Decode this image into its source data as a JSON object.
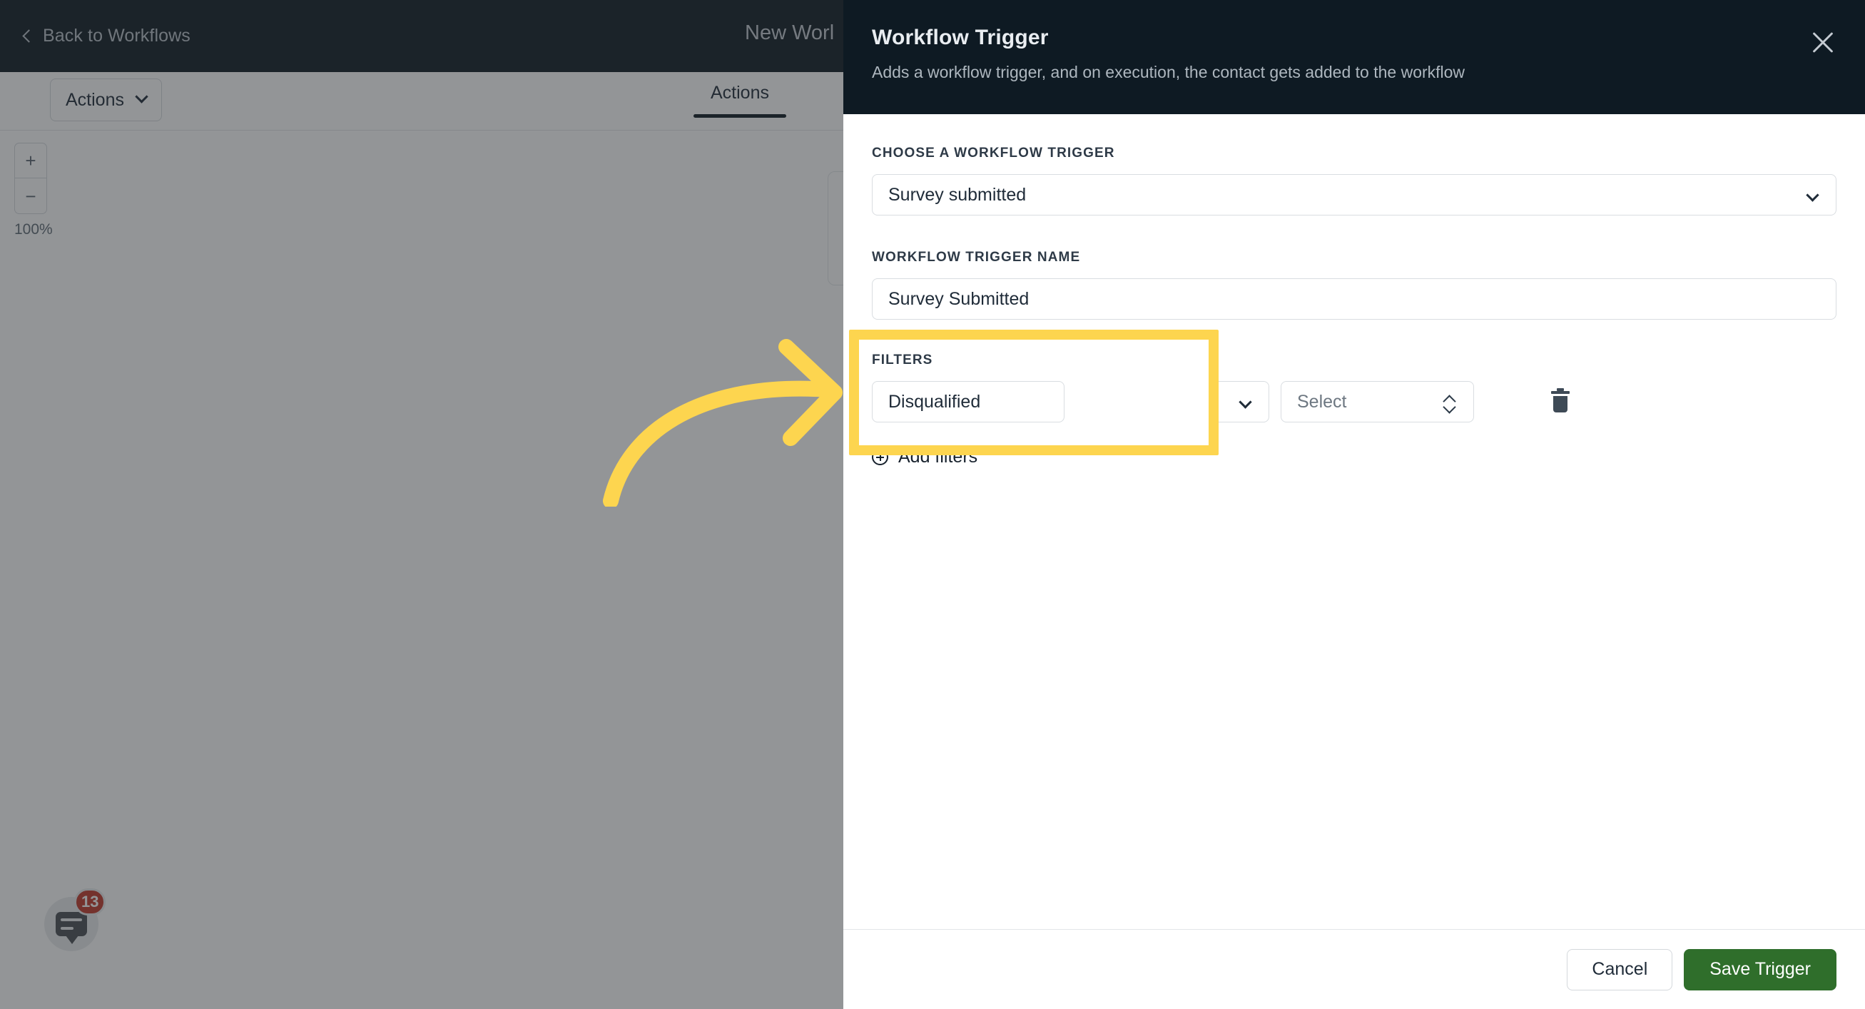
{
  "app": {
    "back_label": "Back to Workflows",
    "back_icon": "chevron-left-icon",
    "title": "New Worl",
    "actions_button": "Actions",
    "actions_caret_icon": "chevron-down-icon",
    "tab_actions": "Actions",
    "zoom_in_icon": "plus-icon",
    "zoom_out_icon": "minus-icon",
    "zoom_level": "100%",
    "chat": {
      "icon": "chat-bubble-icon",
      "badge_count": "13",
      "badge_color": "#c0392b"
    }
  },
  "panel": {
    "title": "Workflow Trigger",
    "subtitle": "Adds a workflow trigger, and on execution, the contact gets added to the workflow",
    "close_icon": "close-icon",
    "choose_trigger": {
      "label": "CHOOSE A WORKFLOW TRIGGER",
      "value": "Survey submitted",
      "caret_icon": "chevron-down-icon"
    },
    "trigger_name": {
      "label": "WORKFLOW TRIGGER NAME",
      "value": "Survey Submitted"
    },
    "filters": {
      "label": "FILTERS",
      "row": {
        "field_value": "Disqualified",
        "field_caret_icon": "chevron-down-icon",
        "operator_value": "",
        "operator_caret_icon": "chevron-down-icon",
        "value_placeholder": "Select",
        "value_spinner_icon": "chevron-up-down-icon",
        "delete_icon": "trash-icon"
      },
      "add_filters_label": "Add filters",
      "add_filters_icon": "plus-circle-icon"
    },
    "footer": {
      "cancel_label": "Cancel",
      "save_label": "Save Trigger",
      "save_color": "#2f6e2b"
    }
  },
  "annotation": {
    "highlight_color": "#fdd54f",
    "arrow_icon": "curved-arrow-right-icon"
  }
}
